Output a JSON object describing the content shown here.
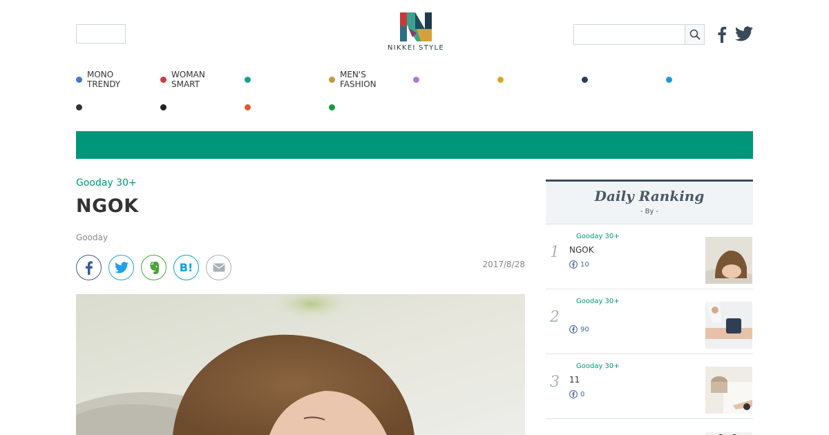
{
  "header": {
    "logo_text": "NIKKEI STYLE",
    "search": {
      "value": "",
      "placeholder": ""
    }
  },
  "nav": {
    "items": [
      {
        "label": "MONO\nTRENDY",
        "color": "#3d7bd0"
      },
      {
        "label": "WOMAN\nSMART",
        "color": "#d03c3c"
      },
      {
        "label": "",
        "color": "#1aa18a"
      },
      {
        "label": "MEN'S\nFASHION",
        "color": "#c49a3a"
      },
      {
        "label": "",
        "color": "#b07ad8"
      },
      {
        "label": "",
        "color": "#d8a82a"
      },
      {
        "label": "",
        "color": "#2e3e5c"
      },
      {
        "label": "",
        "color": "#1f9ad8"
      },
      {
        "label": "",
        "color": "#333333"
      },
      {
        "label": "",
        "color": "#222222"
      },
      {
        "label": "",
        "color": "#e05a30"
      },
      {
        "label": "",
        "color": "#1a9a3a"
      }
    ]
  },
  "article": {
    "category": "Gooday 30+",
    "title": "NGOK",
    "source": "Gooday",
    "date": "2017/8/28"
  },
  "ranking": {
    "title": "Daily Ranking",
    "subtitle": "- By  -",
    "items": [
      {
        "rank": "1",
        "category": "Gooday 30+",
        "title": "NGOK",
        "count": "10"
      },
      {
        "rank": "2",
        "category": "Gooday 30+",
        "title": "",
        "count": "90"
      },
      {
        "rank": "3",
        "category": "Gooday 30+",
        "title": "11",
        "count": "0"
      }
    ]
  },
  "colors": {
    "accent": "#009679",
    "ranking_header_border": "#3b4a5a"
  }
}
